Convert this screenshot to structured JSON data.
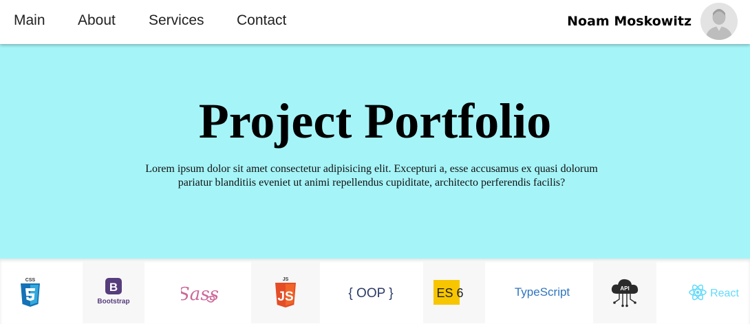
{
  "nav": {
    "links": [
      "Main",
      "About",
      "Services",
      "Contact"
    ]
  },
  "user": {
    "name": "Noam Moskowitz"
  },
  "hero": {
    "title": "Project Portfolio",
    "text": "Lorem ipsum dolor sit amet consectetur adipisicing elit. Excepturi a, esse accusamus ex quasi dolorum pariatur blanditiis eveniet ut animi repellendus cupiditate, architecto perferendis facilis?",
    "background": "#a5f4f8"
  },
  "tech": {
    "items": [
      {
        "icon": "css3-icon",
        "label": "CSS"
      },
      {
        "icon": "bootstrap-icon",
        "label": "Bootstrap"
      },
      {
        "icon": "sass-icon",
        "label": "Sass"
      },
      {
        "icon": "javascript-icon",
        "label": "JS"
      },
      {
        "icon": "oop-icon",
        "label": "{ OOP }"
      },
      {
        "icon": "es6-icon",
        "label": "ES 6"
      },
      {
        "icon": "typescript-icon",
        "label": "TypeScript"
      },
      {
        "icon": "api-icon",
        "label": "API"
      },
      {
        "icon": "react-icon",
        "label": "React"
      }
    ]
  }
}
